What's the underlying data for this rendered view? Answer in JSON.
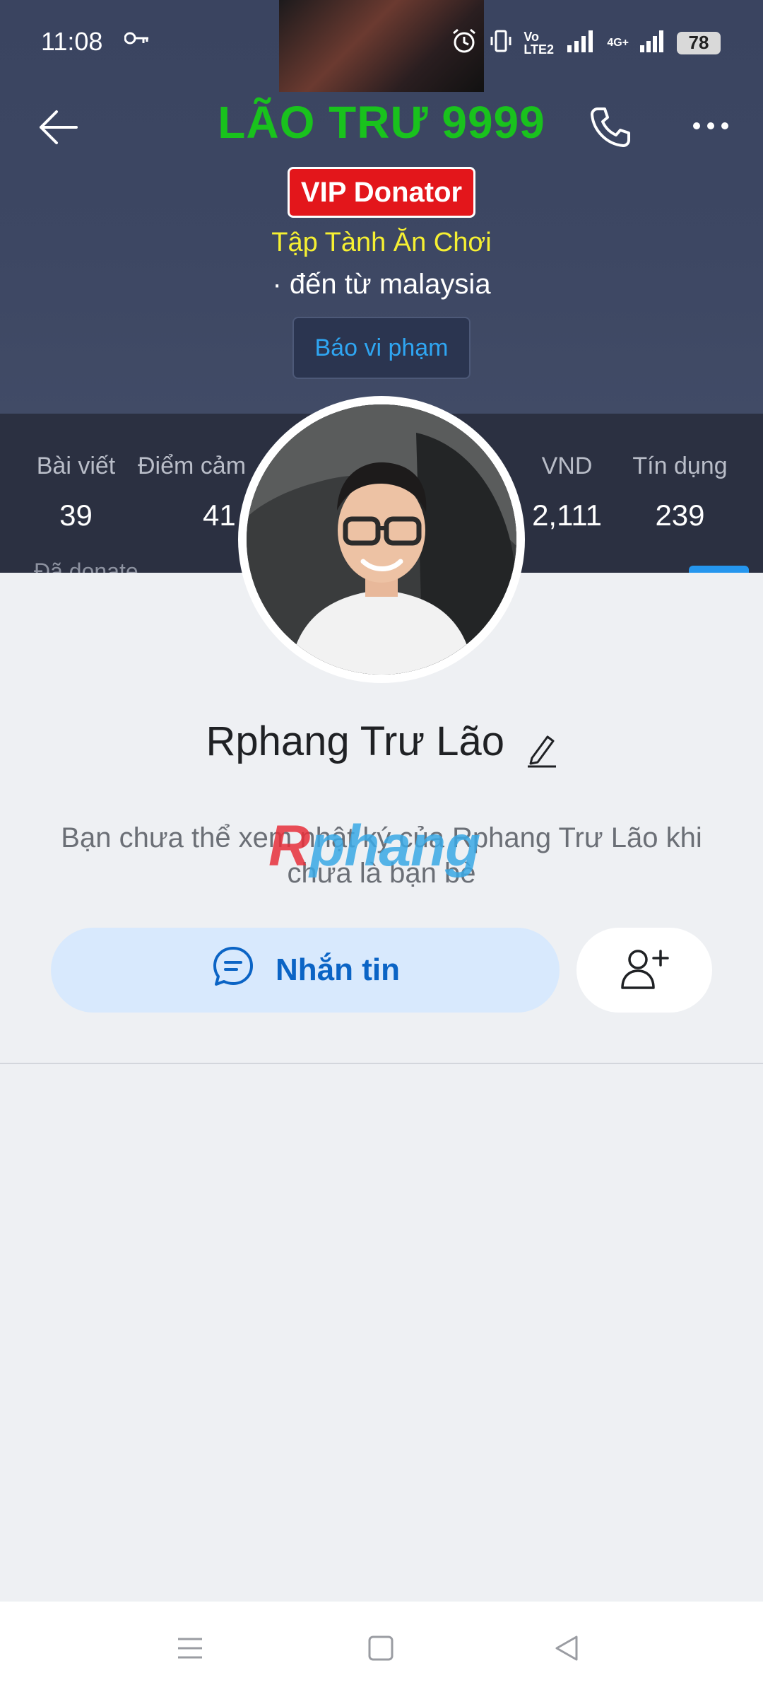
{
  "status_bar": {
    "time": "11:08",
    "network_label": "Vo LTE2",
    "signal_label": "4G+",
    "battery": "78"
  },
  "header": {
    "title": "LÃO TRƯ 9999",
    "badge": "VIP Donator",
    "tagline": "Tập Tành Ăn Chơi",
    "origin": "· đến từ malaysia",
    "report_label": "Báo vi phạm"
  },
  "stats": [
    {
      "label": "Bài viết",
      "value": "39"
    },
    {
      "label": "Điểm cảm",
      "value": "41"
    },
    {
      "label": "VND",
      "value": "2,111"
    },
    {
      "label": "Tín dụng",
      "value": "239"
    }
  ],
  "stats_partial_label": "Đã donate",
  "profile": {
    "name": "Rphang Trư Lão",
    "note": "Bạn chưa thể xem nhật ký của Rphang Trư Lão khi chưa là bạn bè",
    "watermark": "Rphang",
    "message_label": "Nhắn tin"
  },
  "colors": {
    "title_green": "#19c21d",
    "vip_red": "#e3161b",
    "tagline_yellow": "#f6f032",
    "link_blue": "#2fa6f2",
    "message_blue": "#0b64c5"
  },
  "icons": [
    "back-arrow-icon",
    "phone-icon",
    "more-icon",
    "key-icon",
    "alarm-icon",
    "vibrate-icon",
    "signal-icon",
    "edit-pencil-icon",
    "chat-icon",
    "add-friend-icon",
    "menu-icon",
    "home-icon",
    "back-triangle-icon"
  ]
}
